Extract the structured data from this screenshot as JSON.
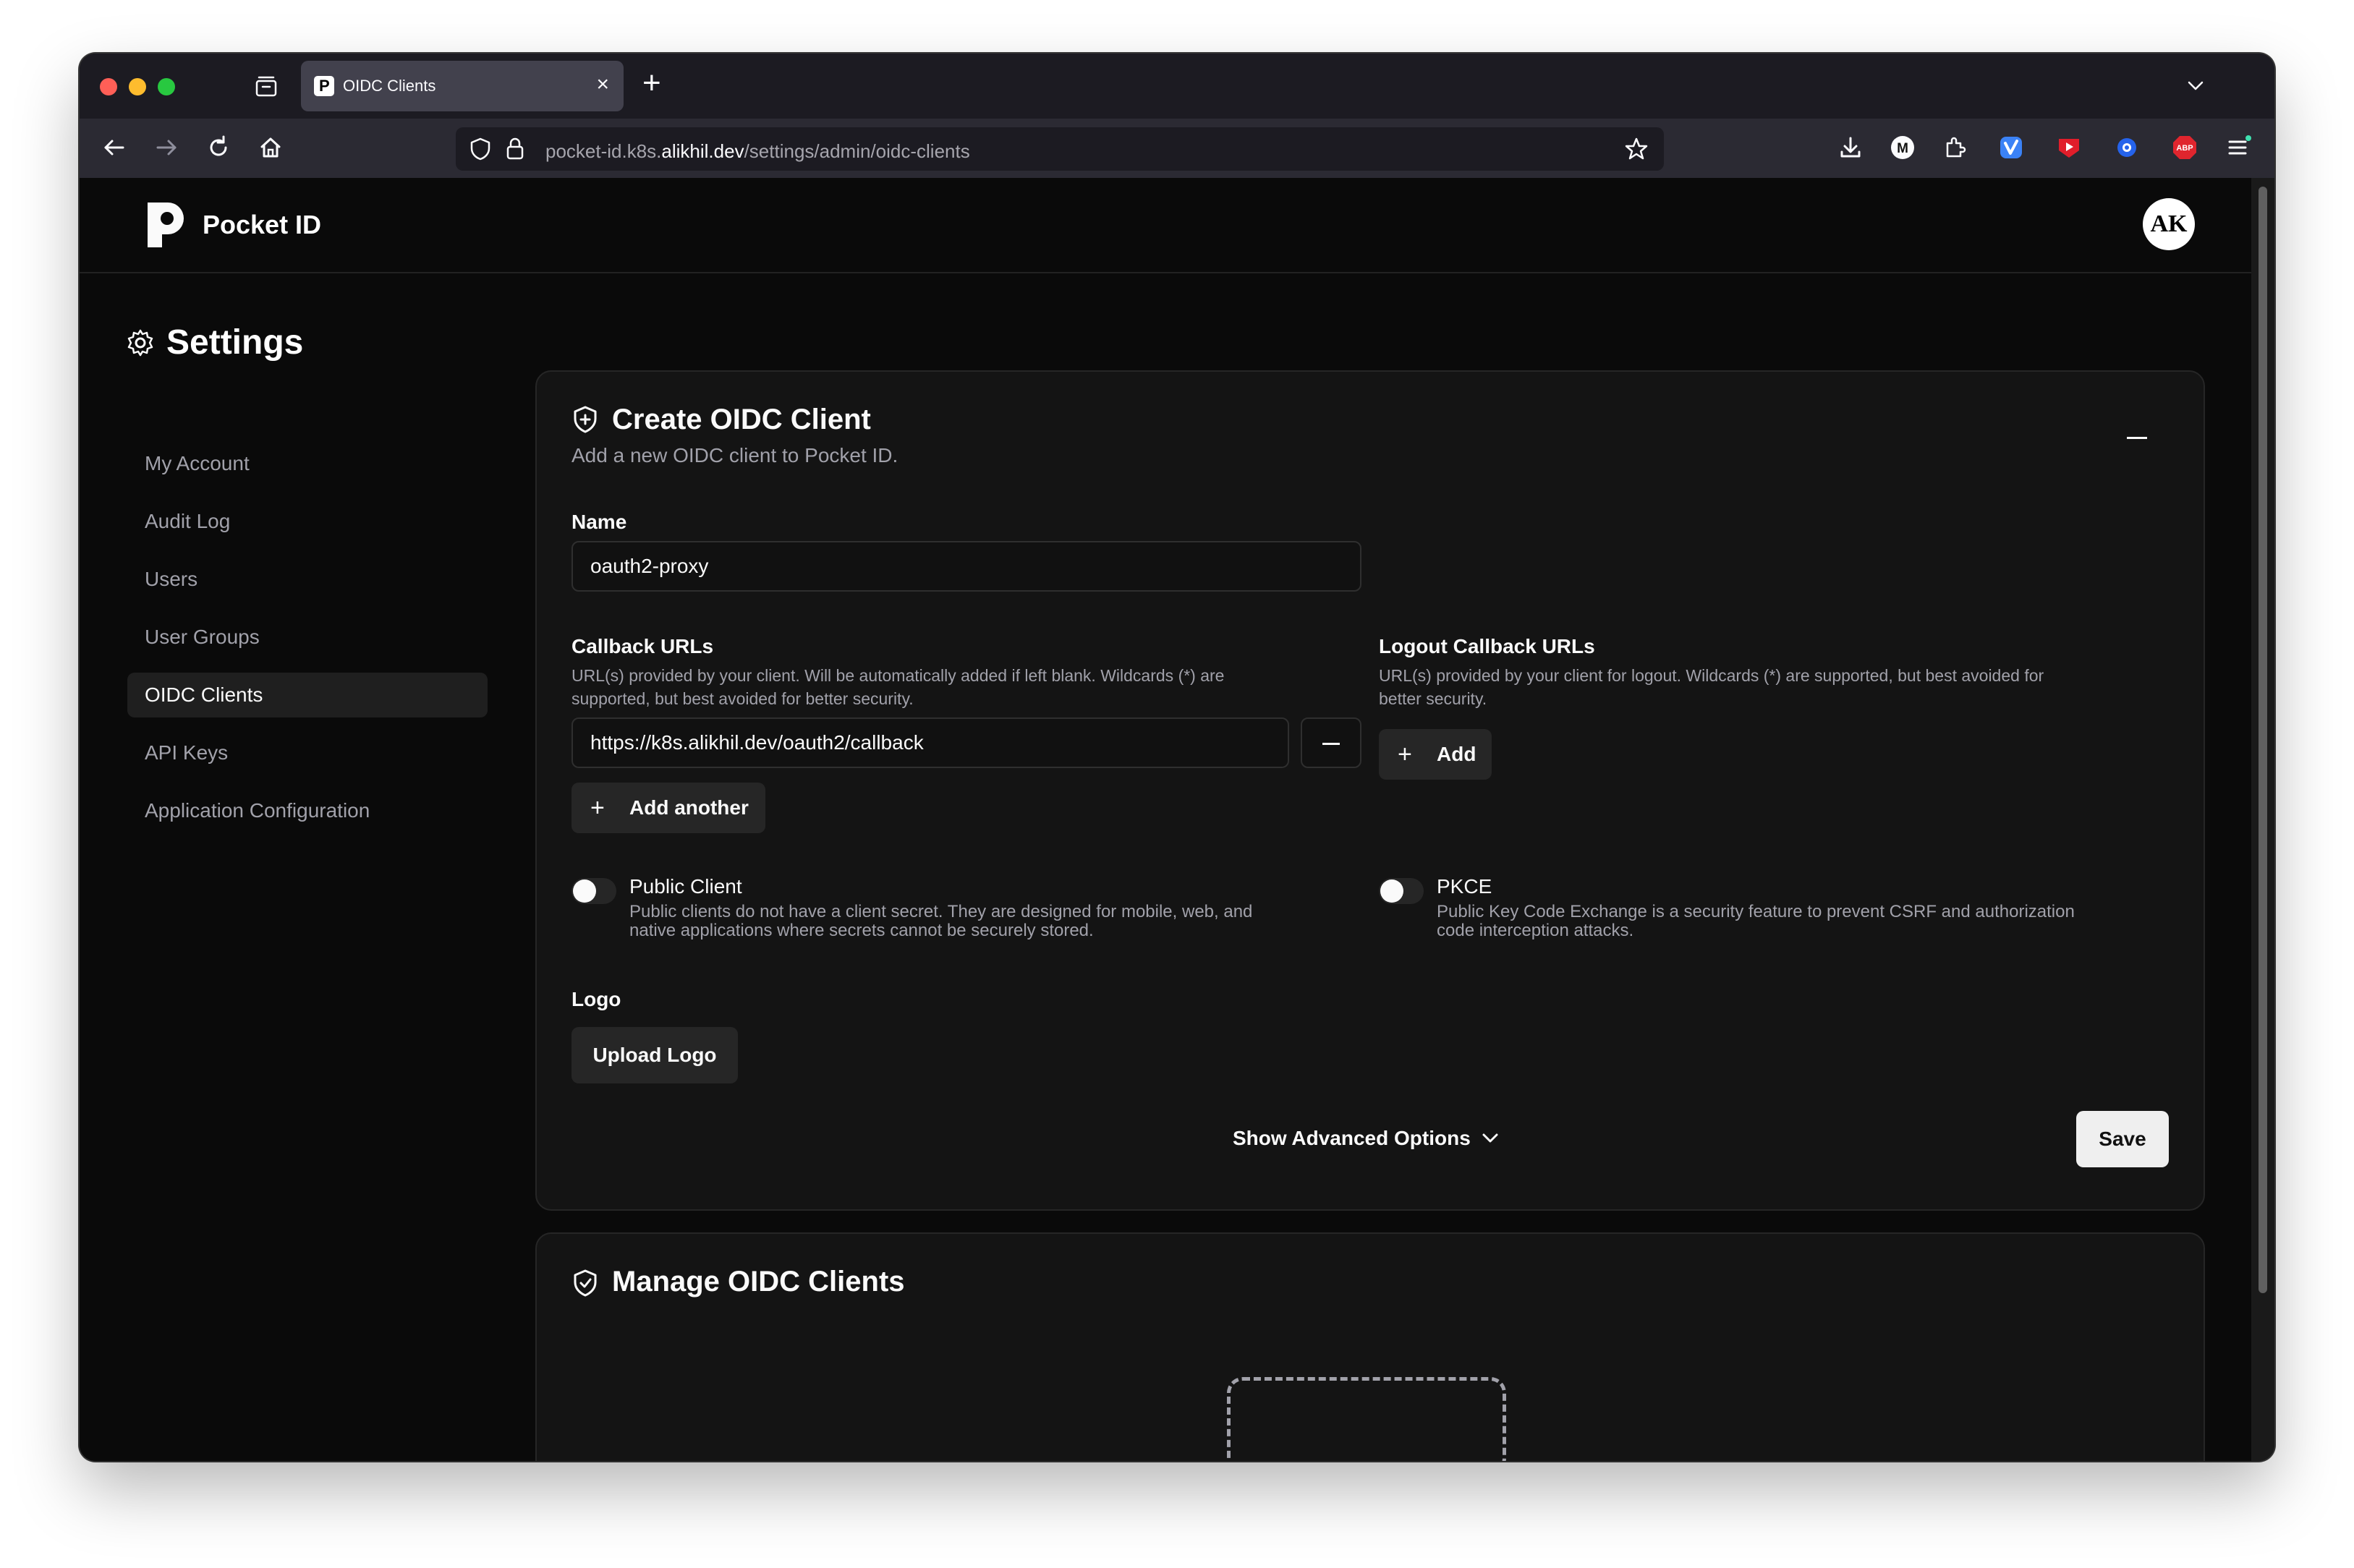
{
  "browser": {
    "tab_title": "OIDC Clients",
    "favicon_letter": "P",
    "url_prefix": "pocket-id.k8s.",
    "url_domain": "alikhil.dev",
    "url_path": "/settings/admin/oidc-clients",
    "extensions": [
      "download-icon",
      "m-extension-icon",
      "puzzle-extensions-icon",
      "vpn-extension-icon",
      "youtube-extension-icon",
      "record-extension-icon",
      "adblock-plus-icon",
      "menu-icon"
    ],
    "extension_labels": {
      "m": "M",
      "abp": "ABP"
    }
  },
  "app": {
    "brand": "Pocket ID",
    "avatar_initials": "AK"
  },
  "sidebar": {
    "title": "Settings",
    "items": [
      {
        "label": "My Account",
        "active": false
      },
      {
        "label": "Audit Log",
        "active": false
      },
      {
        "label": "Users",
        "active": false
      },
      {
        "label": "User Groups",
        "active": false
      },
      {
        "label": "OIDC Clients",
        "active": true
      },
      {
        "label": "API Keys",
        "active": false
      },
      {
        "label": "Application Configuration",
        "active": false
      }
    ]
  },
  "create_card": {
    "title": "Create OIDC Client",
    "subtitle": "Add a new OIDC client to Pocket ID.",
    "name_label": "Name",
    "name_value": "oauth2-proxy",
    "callback_label": "Callback URLs",
    "callback_desc_line1": "URL(s) provided by your client. Will be automatically added if left blank. Wildcards (*) are",
    "callback_desc_line2": "supported, but best avoided for better security.",
    "callback_value": "https://k8s.alikhil.dev/oauth2/callback",
    "add_another_label": "Add another",
    "logout_label": "Logout Callback URLs",
    "logout_desc_line1": "URL(s) provided by your client for logout. Wildcards (*) are supported, but best avoided for",
    "logout_desc_line2": "better security.",
    "add_label": "Add",
    "public_client_label": "Public Client",
    "public_client_desc_line1": "Public clients do not have a client secret. They are designed for mobile, web, and",
    "public_client_desc_line2": "native applications where secrets cannot be securely stored.",
    "public_client_enabled": false,
    "pkce_label": "PKCE",
    "pkce_desc_line1": "Public Key Code Exchange is a security feature to prevent CSRF and authorization",
    "pkce_desc_line2": "code interception attacks.",
    "pkce_enabled": false,
    "logo_label": "Logo",
    "upload_logo_label": "Upload Logo",
    "advanced_label": "Show Advanced Options",
    "save_label": "Save"
  },
  "manage_card": {
    "title": "Manage OIDC Clients"
  },
  "colors": {
    "background": "#0a0a0a",
    "card": "#141414",
    "border": "#262626",
    "muted_text": "#a1a1aa",
    "save_button": "#efefef"
  }
}
